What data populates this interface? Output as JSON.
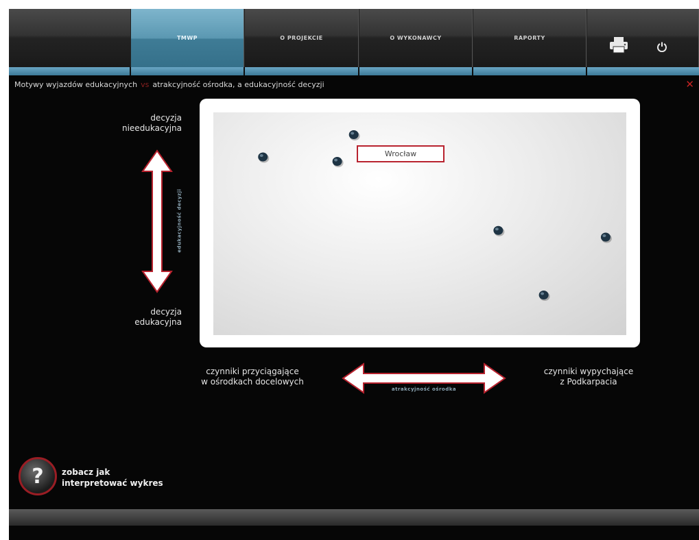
{
  "nav": {
    "tabs": [
      {
        "label": "TMWP",
        "active": true
      },
      {
        "label": "O PROJEKCIE",
        "active": false
      },
      {
        "label": "O WYKONAWCY",
        "active": false
      },
      {
        "label": "RAPORTY",
        "active": false
      }
    ],
    "icons": [
      "printer-icon",
      "power-icon"
    ]
  },
  "breadcrumb": {
    "part1": "Motywy wyjazdów edukacyjnych",
    "separator": "vs",
    "part2": "atrakcyjność ośrodka, a edukacyjność decyzji",
    "close_icon": "close-icon"
  },
  "y_axis": {
    "top_label_line1": "decyzja",
    "top_label_line2": "nieedukacyjna",
    "bottom_label_line1": "decyzja",
    "bottom_label_line2": "edukacyjna",
    "arrow_label": "edukacyjność decyzji"
  },
  "x_axis": {
    "left_label_line1": "czynniki przyciągające",
    "left_label_line2": "w ośrodkach docelowych",
    "right_label_line1": "czynniki wypychające",
    "right_label_line2": "z Podkarpacia",
    "arrow_label": "atrakcyjność ośrodka"
  },
  "tooltip": {
    "label": "Wrocław"
  },
  "help": {
    "icon": "question-icon",
    "line1": "zobacz jak",
    "line2": "interpretować wykres"
  },
  "colors": {
    "accent": "#5b98b2",
    "marker": "#1e3444",
    "highlight": "#b8222e"
  },
  "chart_data": {
    "type": "scatter",
    "xlabel": "atrakcyjność ośrodka",
    "ylabel": "edukacyjność decyzji",
    "xlim": [
      0,
      1
    ],
    "ylim": [
      0,
      1
    ],
    "points": [
      {
        "x": 0.12,
        "y": 0.8
      },
      {
        "x": 0.3,
        "y": 0.78
      },
      {
        "x": 0.34,
        "y": 0.9
      },
      {
        "x": 0.69,
        "y": 0.47
      },
      {
        "x": 0.95,
        "y": 0.44
      },
      {
        "x": 0.8,
        "y": 0.18
      }
    ]
  }
}
